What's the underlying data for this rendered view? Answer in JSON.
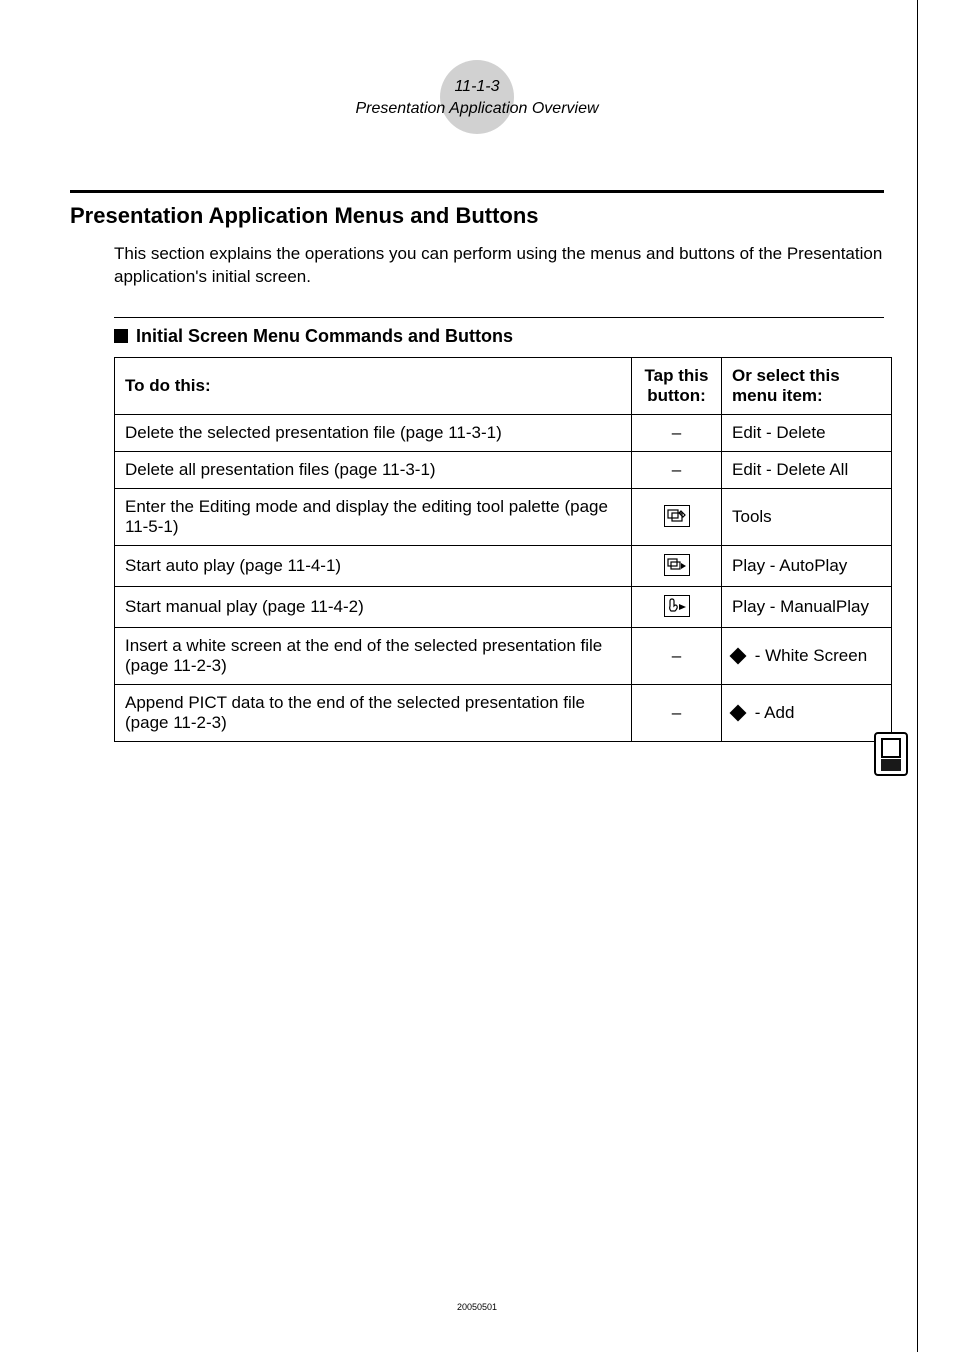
{
  "header": {
    "page_num": "11-1-3",
    "section": "Presentation Application Overview"
  },
  "h1": "Presentation Application Menus and Buttons",
  "intro": "This section explains the operations you can perform using the menus and buttons of the Presentation application's initial screen.",
  "h2": "Initial Screen Menu Commands and Buttons",
  "table": {
    "headers": {
      "todo": "To do this:",
      "tap": "Tap this button:",
      "menu": "Or select this menu item:"
    },
    "rows": [
      {
        "todo": "Delete the selected presentation file (page 11-3-1)",
        "tap": "–",
        "menu": "Edit - Delete",
        "icon": null,
        "diamond": false
      },
      {
        "todo": "Delete all presentation files (page 11-3-1)",
        "tap": "–",
        "menu": "Edit - Delete All",
        "icon": null,
        "diamond": false
      },
      {
        "todo": "Enter the Editing mode and display the editing tool palette (page 11-5-1)",
        "tap": "",
        "menu": "Tools",
        "icon": "tools",
        "diamond": false
      },
      {
        "todo": "Start auto play (page 11-4-1)",
        "tap": "",
        "menu": "Play - AutoPlay",
        "icon": "autoplay",
        "diamond": false
      },
      {
        "todo": "Start manual play (page 11-4-2)",
        "tap": "",
        "menu": "Play - ManualPlay",
        "icon": "manualplay",
        "diamond": false
      },
      {
        "todo": "Insert a white screen at the end of the selected presentation file (page 11-2-3)",
        "tap": "–",
        "menu": " - White Screen",
        "icon": null,
        "diamond": true
      },
      {
        "todo": "Append PICT data to the end of the selected presentation file (page 11-2-3)",
        "tap": "–",
        "menu": " - Add",
        "icon": null,
        "diamond": true
      }
    ]
  },
  "footer_num": "20050501"
}
